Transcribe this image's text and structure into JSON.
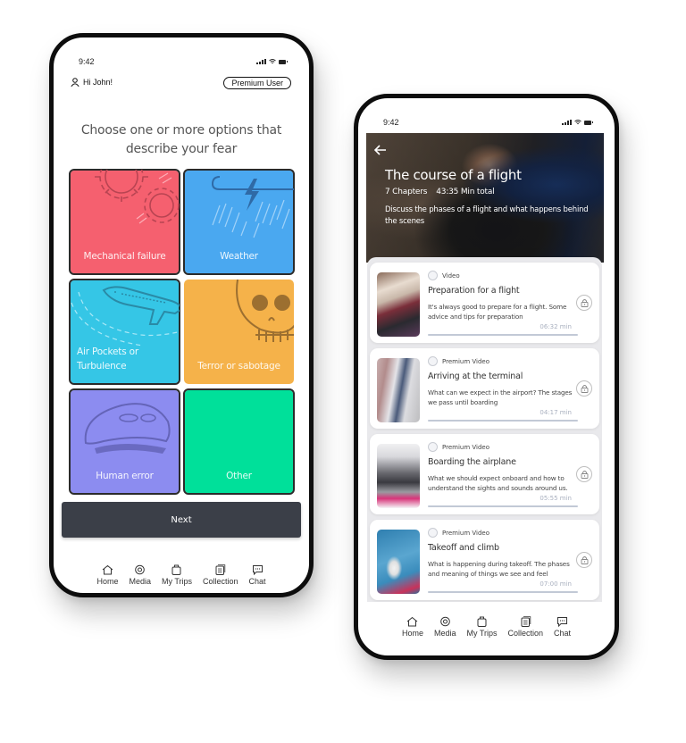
{
  "left_screen": {
    "status_bar": {
      "time": "9:42"
    },
    "greeting": "Hi John!",
    "badge": "Premium User",
    "prompt": "Choose one or more options that describe your fear",
    "fears": [
      {
        "label": "Mechanical failure",
        "color": "#f5606f",
        "icon": "gears-icon",
        "selected": true
      },
      {
        "label": "Weather",
        "color": "#4aa8f0",
        "icon": "storm-icon",
        "selected": true
      },
      {
        "label": "Air Pockets or Turbulence",
        "color": "#35c6e6",
        "icon": "airplane-icon",
        "selected": true
      },
      {
        "label": "Terror or sabotage",
        "color": "#f5b24a",
        "icon": "skull-icon",
        "selected": false
      },
      {
        "label": "Human error",
        "color": "#8c8cf0",
        "icon": "pilot-cap-icon",
        "selected": true
      },
      {
        "label": "Other",
        "color": "#00e09a",
        "icon": "none",
        "selected": true
      }
    ],
    "next_label": "Next",
    "tabs": [
      {
        "label": "Home",
        "icon": "home-icon"
      },
      {
        "label": "Media",
        "icon": "media-icon"
      },
      {
        "label": "My Trips",
        "icon": "suitcase-icon"
      },
      {
        "label": "Collection",
        "icon": "collection-icon"
      },
      {
        "label": "Chat",
        "icon": "chat-icon"
      }
    ]
  },
  "right_screen": {
    "status_bar": {
      "time": "9:42"
    },
    "course": {
      "title": "The course of a flight",
      "chapters": "7 Chapters",
      "total": "43:35 Min total",
      "description": "Discuss the phases of a flight and what happens behind the scenes"
    },
    "chapters": [
      {
        "type": "Video",
        "title": "Preparation for a flight",
        "description": "It's always good to prepare for a flight. Some advice and tips for preparation",
        "duration": "06:32 min",
        "locked": true,
        "progress": 0
      },
      {
        "type": "Premium Video",
        "title": "Arriving at the terminal",
        "description": "What can we expect in the airport? The stages we pass until boarding",
        "duration": "04:17 min",
        "locked": true,
        "progress": 0
      },
      {
        "type": "Premium Video",
        "title": "Boarding the airplane",
        "description": "What we should expect onboard and how to understand the sights and sounds around us.",
        "duration": "05:55 min",
        "locked": true,
        "progress": 0
      },
      {
        "type": "Premium Video",
        "title": "Takeoff and climb",
        "description": "What is happening during takeoff. The phases and meaning of things we see and feel",
        "duration": "07:00 min",
        "locked": true,
        "progress": 0
      }
    ],
    "tabs": [
      {
        "label": "Home",
        "icon": "home-icon"
      },
      {
        "label": "Media",
        "icon": "media-icon"
      },
      {
        "label": "My Trips",
        "icon": "suitcase-icon"
      },
      {
        "label": "Collection",
        "icon": "collection-icon"
      },
      {
        "label": "Chat",
        "icon": "chat-icon"
      }
    ]
  }
}
